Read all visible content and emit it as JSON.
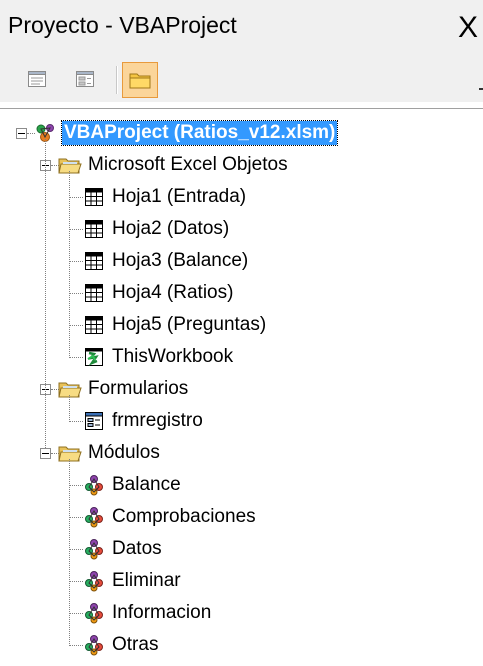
{
  "window": {
    "title": "Proyecto - VBAProject",
    "close_glyph": "X"
  },
  "toolbar": {
    "buttons": [
      {
        "name": "view-code-button",
        "icon": "view-code-icon",
        "active": false
      },
      {
        "name": "view-object-button",
        "icon": "view-object-icon",
        "active": false
      },
      {
        "name": "toggle-folders-button",
        "icon": "folder-icon",
        "active": true
      }
    ]
  },
  "tree": {
    "project": {
      "label": "VBAProject (Ratios_v12.xlsm)",
      "icon": "vba-project-icon",
      "selected": true
    },
    "excel_objects": {
      "label": "Microsoft Excel Objetos",
      "icon": "folder-open-icon",
      "items": [
        {
          "label": "Hoja1 (Entrada)",
          "icon": "worksheet-icon"
        },
        {
          "label": "Hoja2 (Datos)",
          "icon": "worksheet-icon"
        },
        {
          "label": "Hoja3 (Balance)",
          "icon": "worksheet-icon"
        },
        {
          "label": "Hoja4 (Ratios)",
          "icon": "worksheet-icon"
        },
        {
          "label": "Hoja5 (Preguntas)",
          "icon": "worksheet-icon"
        },
        {
          "label": "ThisWorkbook",
          "icon": "workbook-icon"
        }
      ]
    },
    "forms": {
      "label": "Formularios",
      "icon": "folder-open-icon",
      "items": [
        {
          "label": "frmregistro",
          "icon": "userform-icon"
        }
      ]
    },
    "modules": {
      "label": "Módulos",
      "icon": "folder-open-icon",
      "items": [
        {
          "label": "Balance",
          "icon": "module-icon"
        },
        {
          "label": "Comprobaciones",
          "icon": "module-icon"
        },
        {
          "label": "Datos",
          "icon": "module-icon"
        },
        {
          "label": "Eliminar",
          "icon": "module-icon"
        },
        {
          "label": "Informacion",
          "icon": "module-icon"
        },
        {
          "label": "Otras",
          "icon": "module-icon"
        }
      ]
    }
  },
  "colors": {
    "selection_bg": "#3399ff",
    "toolbar_active_bg": "#fbd59a",
    "chrome_bg": "#f0f0f0"
  }
}
